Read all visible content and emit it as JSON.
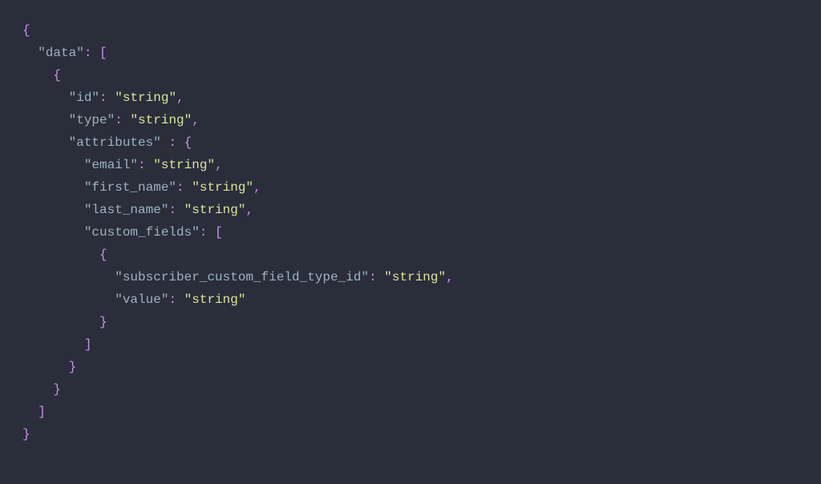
{
  "tokens": [
    [
      {
        "c": "punct",
        "t": "{"
      }
    ],
    [
      {
        "c": null,
        "t": "  "
      },
      {
        "c": "key",
        "t": "\"data\""
      },
      {
        "c": "punct",
        "t": ":"
      },
      {
        "c": null,
        "t": " "
      },
      {
        "c": "punct",
        "t": "["
      }
    ],
    [
      {
        "c": null,
        "t": "    "
      },
      {
        "c": "punct",
        "t": "{"
      }
    ],
    [
      {
        "c": null,
        "t": "      "
      },
      {
        "c": "key",
        "t": "\"id\""
      },
      {
        "c": "punct",
        "t": ":"
      },
      {
        "c": null,
        "t": " "
      },
      {
        "c": "string",
        "t": "\"string\""
      },
      {
        "c": "punct",
        "t": ","
      }
    ],
    [
      {
        "c": null,
        "t": "      "
      },
      {
        "c": "key",
        "t": "\"type\""
      },
      {
        "c": "punct",
        "t": ":"
      },
      {
        "c": null,
        "t": " "
      },
      {
        "c": "string",
        "t": "\"string\""
      },
      {
        "c": "punct",
        "t": ","
      }
    ],
    [
      {
        "c": null,
        "t": "      "
      },
      {
        "c": "key",
        "t": "\"attributes\""
      },
      {
        "c": null,
        "t": " "
      },
      {
        "c": "punct",
        "t": ":"
      },
      {
        "c": null,
        "t": " "
      },
      {
        "c": "punct",
        "t": "{"
      }
    ],
    [
      {
        "c": null,
        "t": "        "
      },
      {
        "c": "key",
        "t": "\"email\""
      },
      {
        "c": "punct",
        "t": ":"
      },
      {
        "c": null,
        "t": " "
      },
      {
        "c": "string",
        "t": "\"string\""
      },
      {
        "c": "punct",
        "t": ","
      }
    ],
    [
      {
        "c": null,
        "t": "        "
      },
      {
        "c": "key",
        "t": "\"first_name\""
      },
      {
        "c": "punct",
        "t": ":"
      },
      {
        "c": null,
        "t": " "
      },
      {
        "c": "string",
        "t": "\"string\""
      },
      {
        "c": "punct",
        "t": ","
      }
    ],
    [
      {
        "c": null,
        "t": "        "
      },
      {
        "c": "key",
        "t": "\"last_name\""
      },
      {
        "c": "punct",
        "t": ":"
      },
      {
        "c": null,
        "t": " "
      },
      {
        "c": "string",
        "t": "\"string\""
      },
      {
        "c": "punct",
        "t": ","
      }
    ],
    [
      {
        "c": null,
        "t": "        "
      },
      {
        "c": "key",
        "t": "\"custom_fields\""
      },
      {
        "c": "punct",
        "t": ":"
      },
      {
        "c": null,
        "t": " "
      },
      {
        "c": "punct",
        "t": "["
      }
    ],
    [
      {
        "c": null,
        "t": "          "
      },
      {
        "c": "punct",
        "t": "{"
      }
    ],
    [
      {
        "c": null,
        "t": "            "
      },
      {
        "c": "key",
        "t": "\"subscriber_custom_field_type_id\""
      },
      {
        "c": "punct",
        "t": ":"
      },
      {
        "c": null,
        "t": " "
      },
      {
        "c": "string",
        "t": "\"string\""
      },
      {
        "c": "punct",
        "t": ","
      }
    ],
    [
      {
        "c": null,
        "t": "            "
      },
      {
        "c": "key",
        "t": "\"value\""
      },
      {
        "c": "punct",
        "t": ":"
      },
      {
        "c": null,
        "t": " "
      },
      {
        "c": "string",
        "t": "\"string\""
      }
    ],
    [
      {
        "c": null,
        "t": "          "
      },
      {
        "c": "punct",
        "t": "}"
      }
    ],
    [
      {
        "c": null,
        "t": "        "
      },
      {
        "c": "punct",
        "t": "]"
      }
    ],
    [
      {
        "c": null,
        "t": "      "
      },
      {
        "c": "punct",
        "t": "}"
      }
    ],
    [
      {
        "c": null,
        "t": "    "
      },
      {
        "c": "punct",
        "t": "}"
      }
    ],
    [
      {
        "c": null,
        "t": "  "
      },
      {
        "c": "punct",
        "t": "]"
      }
    ],
    [
      {
        "c": "punct",
        "t": "}"
      }
    ]
  ]
}
